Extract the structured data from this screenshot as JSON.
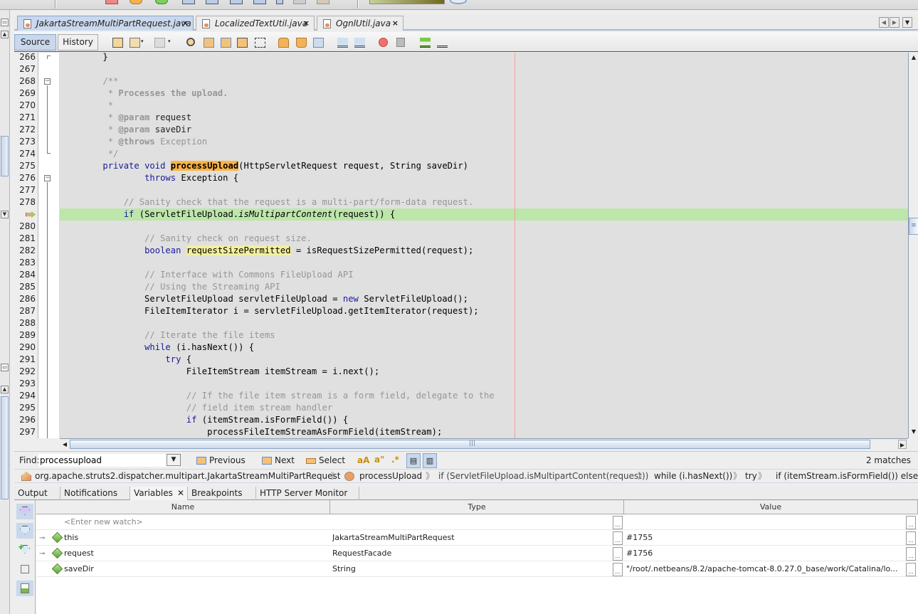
{
  "editor_tabs": [
    {
      "label": "JakartaStreamMultiPartRequest.java",
      "active": true
    },
    {
      "label": "LocalizedTextUtil.java",
      "active": false
    },
    {
      "label": "OgnlUtil.java",
      "active": false
    }
  ],
  "source_toolbar": {
    "source_label": "Source",
    "history_label": "History"
  },
  "line_numbers": [
    "266",
    "267",
    "268",
    "269",
    "270",
    "271",
    "272",
    "273",
    "274",
    "275",
    "276",
    "277",
    "278",
    "",
    "280",
    "281",
    "282",
    "283",
    "284",
    "285",
    "286",
    "287",
    "288",
    "289",
    "290",
    "291",
    "292",
    "293",
    "294",
    "295",
    "296",
    "297"
  ],
  "current_line_marker": "program-counter-icon",
  "code_lines": [
    "    }",
    "",
    "    /**",
    "     * Processes the upload.",
    "     *",
    "     * @param request",
    "     * @param saveDir",
    "     * @throws Exception",
    "     */",
    "    private void processUpload(HttpServletRequest request, String saveDir)",
    "            throws Exception {",
    "",
    "        // Sanity check that the request is a multi-part/form-data request.",
    "        if (ServletFileUpload.isMultipartContent(request)) {",
    "",
    "            // Sanity check on request size.",
    "            boolean requestSizePermitted = isRequestSizePermitted(request);",
    "",
    "            // Interface with Commons FileUpload API",
    "            // Using the Streaming API",
    "            ServletFileUpload servletFileUpload = new ServletFileUpload();",
    "            FileItemIterator i = servletFileUpload.getItemIterator(request);",
    "",
    "            // Iterate the file items",
    "            while (i.hasNext()) {",
    "                try {",
    "                    FileItemStream itemStream = i.next();",
    "",
    "                    // If the file item stream is a form field, delegate to the",
    "                    // field item stream handler",
    "                    if (itemStream.isFormField()) {",
    "                        processFileItemStreamAsFormField(itemStream);"
  ],
  "find_bar": {
    "label": "Find:",
    "value": "processupload",
    "previous_label": "Previous",
    "next_label": "Next",
    "select_label": "Select",
    "matches": "2 matches"
  },
  "breadcrumbs": [
    "org.apache.struts2.dispatcher.multipart.JakartaStreamMultiPartRequest",
    "processUpload",
    "if (ServletFileUpload.isMultipartContent(request))",
    "while (i.hasNext())",
    "try",
    "if (itemStream.isFormField()) else"
  ],
  "output_tabs": [
    {
      "label": "Output",
      "active": false
    },
    {
      "label": "Notifications",
      "active": false
    },
    {
      "label": "Variables",
      "active": true
    },
    {
      "label": "Breakpoints",
      "active": false
    },
    {
      "label": "HTTP Server Monitor",
      "active": false
    }
  ],
  "variables": {
    "columns": [
      "Name",
      "Type",
      "Value"
    ],
    "new_watch_placeholder": "<Enter new watch>",
    "ellipsis": "...",
    "rows": [
      {
        "name": "this",
        "type": "JakartaStreamMultiPartRequest",
        "value": "#1755",
        "expandable": true
      },
      {
        "name": "request",
        "type": "RequestFacade",
        "value": "#1756",
        "expandable": true
      },
      {
        "name": "saveDir",
        "type": "String",
        "value": "\"/root/.netbeans/8.2/apache-tomcat-8.0.27.0_base/work/Catalina/lo...",
        "expandable": false
      }
    ]
  },
  "colors": {
    "current_line": "#bde6aa",
    "search_match": "#ffb442",
    "mark_occurrence": "#f2f09e",
    "keyword": "#1a1a9a",
    "comment": "#969696",
    "selection_accent": "#c9d8ec"
  }
}
